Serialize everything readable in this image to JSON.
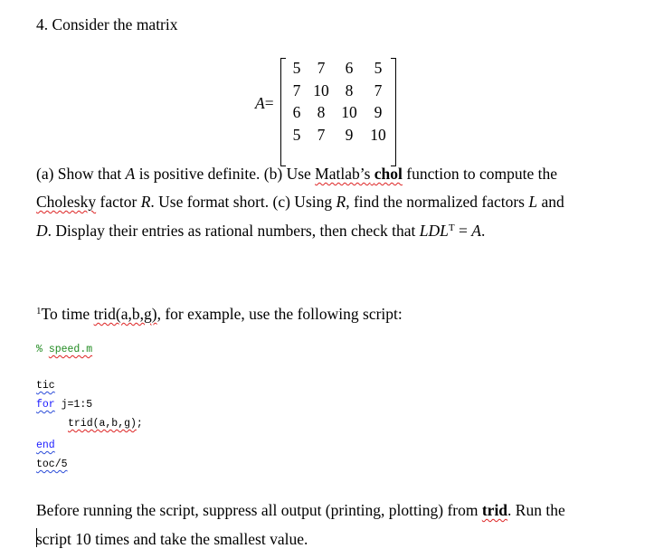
{
  "problem": {
    "heading": "4. Consider the matrix",
    "matrix": {
      "label": "A",
      "equals": "=",
      "rows": [
        [
          "5",
          "7",
          "6",
          "5"
        ],
        [
          "7",
          "10",
          "8",
          "7"
        ],
        [
          "6",
          "8",
          "10",
          "9"
        ],
        [
          "5",
          "7",
          "9",
          "10"
        ]
      ]
    },
    "paragraph": {
      "line1": {
        "p1": "(a) Show that ",
        "var_a": "A",
        "p2": " is positive definite. (b) Use ",
        "matlabs": "Matlab’s",
        "space1": " ",
        "chol": "chol",
        "p3": " function to compute the"
      },
      "line2": {
        "cholesky": "Cholesky",
        "p1": " factor ",
        "var_r": "R",
        "p2": ". Use format short. (c) Using ",
        "var_r2": "R",
        "p3": ", find the normalized factors ",
        "var_l": "L",
        "p4": " and"
      },
      "line3": {
        "var_d": "D",
        "p1": ". Display their entries as rational numbers, then check that ",
        "ldl": "LDL",
        "sup_t": "T",
        "p2": " = ",
        "var_a": "A",
        "p3": "."
      }
    }
  },
  "footnote": {
    "marker": "1",
    "p1": "To time ",
    "trid_call": "trid(a,b,g)",
    "p2": ", for example, use the following script:"
  },
  "code": {
    "comment_mark": "% ",
    "comment_file": "speed.m",
    "lines": {
      "tic": "tic",
      "for_kw": "for",
      "for_rest": " j=1:5",
      "body_call": "trid(a,b,g)",
      "body_semicolon": ";",
      "end": "end",
      "toc": "toc/5"
    }
  },
  "closing": {
    "line1": {
      "p1": "Before running the script, suppress all output (printing, plotting) from ",
      "trid": "trid",
      "p2": ". Run the"
    },
    "line2": "script 10 times and take the smallest value."
  }
}
